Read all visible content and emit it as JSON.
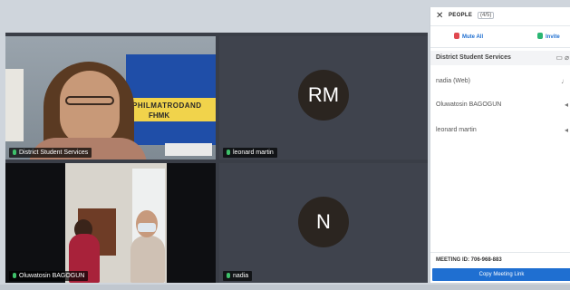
{
  "videos": [
    {
      "name": "District Student Services",
      "poster_line1": "PHILMATRODAND",
      "poster_line2": "FHMK"
    },
    {
      "name": "leonard martin",
      "initials": "RM"
    },
    {
      "name": "Oluwatosin BAGOGUN"
    },
    {
      "name": "nadia",
      "initials": "N"
    }
  ],
  "panel": {
    "close_icon": "close-icon",
    "title": "PEOPLE",
    "count": "(4/5)",
    "mute_all": "Mute All",
    "invite": "Invite",
    "org": {
      "name": "District Student Services"
    },
    "participants": [
      {
        "name": "nadia (Web)"
      },
      {
        "name": "Oluwatosin BAGOGUN"
      },
      {
        "name": "leonard martin"
      }
    ],
    "meeting_id": "MEETING ID: 706-968-883",
    "copy_link": "Copy Meeting Link"
  },
  "colors": {
    "accent": "#1f6fd1",
    "mic_on": "#3ec16a",
    "mute_red": "#e0484f",
    "invite_green": "#2bb673"
  }
}
